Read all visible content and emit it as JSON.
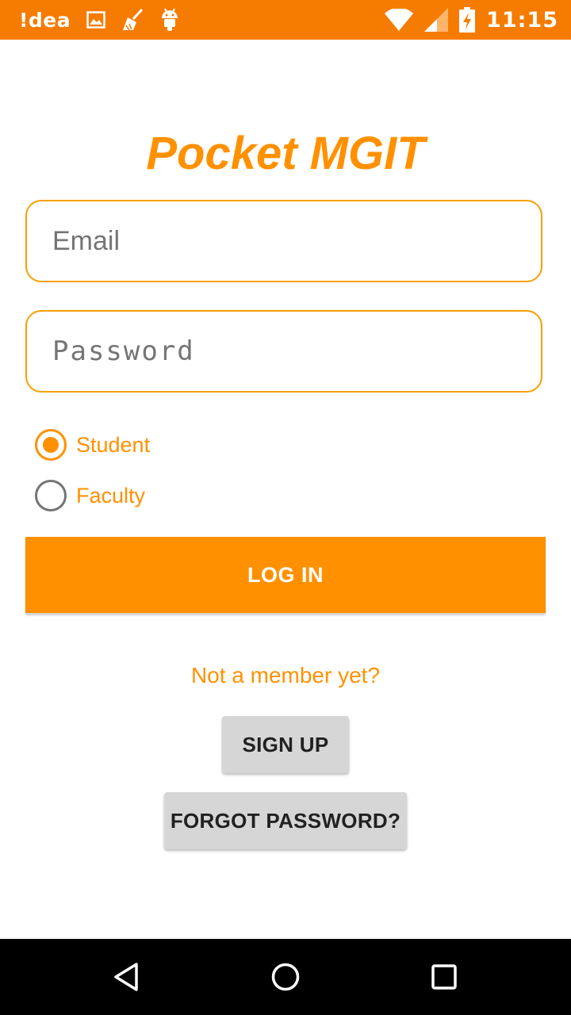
{
  "status_bar": {
    "carrier": "!dea",
    "time": "11:15",
    "left_icons": [
      "image-icon",
      "broom-icon",
      "android-icon"
    ],
    "right_icons": [
      "wifi-icon",
      "signal-icon",
      "battery-charging-icon"
    ],
    "color": "#F57C00"
  },
  "app": {
    "title": "Pocket MGIT",
    "accent_color": "#FF9100"
  },
  "form": {
    "email_placeholder": "Email",
    "email_value": "",
    "password_placeholder": "Password",
    "password_value": "",
    "roles": [
      {
        "label": "Student",
        "checked": true
      },
      {
        "label": "Faculty",
        "checked": false
      }
    ],
    "login_label": "LOG IN"
  },
  "footer": {
    "member_prompt": "Not a member yet?",
    "signup_label": "SIGN UP",
    "forgot_label": "FORGOT PASSWORD?"
  },
  "nav_bar": {
    "buttons": [
      "back-icon",
      "home-icon",
      "recent-apps-icon"
    ]
  }
}
